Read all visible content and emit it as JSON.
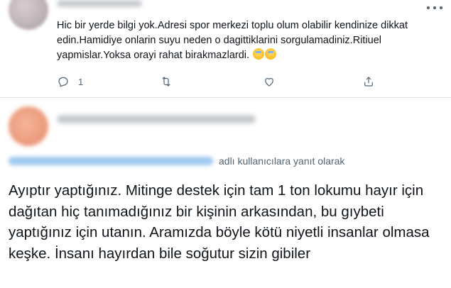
{
  "tweet1": {
    "text": "Hic bir yerde bilgi yok.Adresi spor merkezi toplu olum olabilir kendinize dikkat edin.Hamidiye onlarin suyu neden o dagittiklarini sorgulamadiniz.Ritiuel yapmislar.Yoksa orayi rahat birakmazlardi.",
    "reply_count": "1",
    "icons": [
      "more-icon",
      "reply-icon",
      "retweet-icon",
      "like-icon",
      "share-icon"
    ]
  },
  "tweet2": {
    "reply_to_label": "adlı kullanıcılara yanıt olarak",
    "text": "Ayıptır yaptığınız. Mitinge destek için tam 1 ton lokumu hayır için dağıtan hiç tanımadığınız bir kişinin arkasından, bu gıybeti yaptığınız için utanın. Aramızda böyle kötü niyetli insanlar olmasa keşke. İnsanı hayırdan bile soğutur sizin gibiler"
  }
}
